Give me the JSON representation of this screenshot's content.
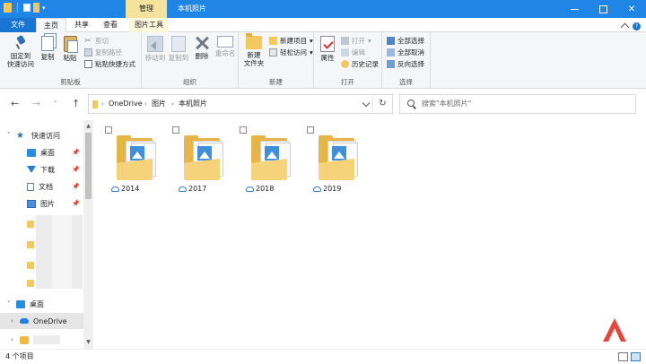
{
  "window": {
    "context_tab": "管理",
    "title": "本机照片"
  },
  "ribbon_tabs": {
    "file": "文件",
    "home": "主页",
    "share": "共享",
    "view": "查看",
    "picture_tools": "图片工具"
  },
  "ribbon": {
    "clipboard": {
      "label": "剪贴板",
      "pin": "固定到\n快速访问",
      "copy": "复制",
      "paste": "粘贴",
      "cut": "剪切",
      "copy_path": "复制路径",
      "paste_shortcut": "粘贴快捷方式"
    },
    "organize": {
      "label": "组织",
      "move_to": "移动到",
      "copy_to": "复制到",
      "delete": "删除",
      "rename": "重命名"
    },
    "new": {
      "label": "新建",
      "new_folder": "新建\n文件夹",
      "new_item": "新建项目",
      "easy_access": "轻松访问"
    },
    "open": {
      "label": "打开",
      "properties": "属性",
      "open": "打开",
      "edit": "编辑",
      "history": "历史记录"
    },
    "select": {
      "label": "选择",
      "select_all": "全部选择",
      "select_none": "全部取消",
      "invert": "反向选择"
    }
  },
  "address": {
    "crumbs": [
      "OneDrive",
      "图片",
      "本机照片"
    ],
    "search_placeholder": "搜索\"本机照片\""
  },
  "nav_pane": {
    "quick_access": "快速访问",
    "items": [
      "桌面",
      "下载",
      "文档",
      "图片"
    ],
    "desktop": "桌面",
    "onedrive": "OneDrive"
  },
  "folders": [
    {
      "name": "2014"
    },
    {
      "name": "2017"
    },
    {
      "name": "2018"
    },
    {
      "name": "2019"
    }
  ],
  "status": {
    "count": "4 个项目"
  },
  "colors": {
    "title_bar": "#1f86e6",
    "file_tab": "#1a75d2",
    "manage_tab": "#f5e39d",
    "folder": "#e7b547",
    "logo": "#e8463a"
  }
}
